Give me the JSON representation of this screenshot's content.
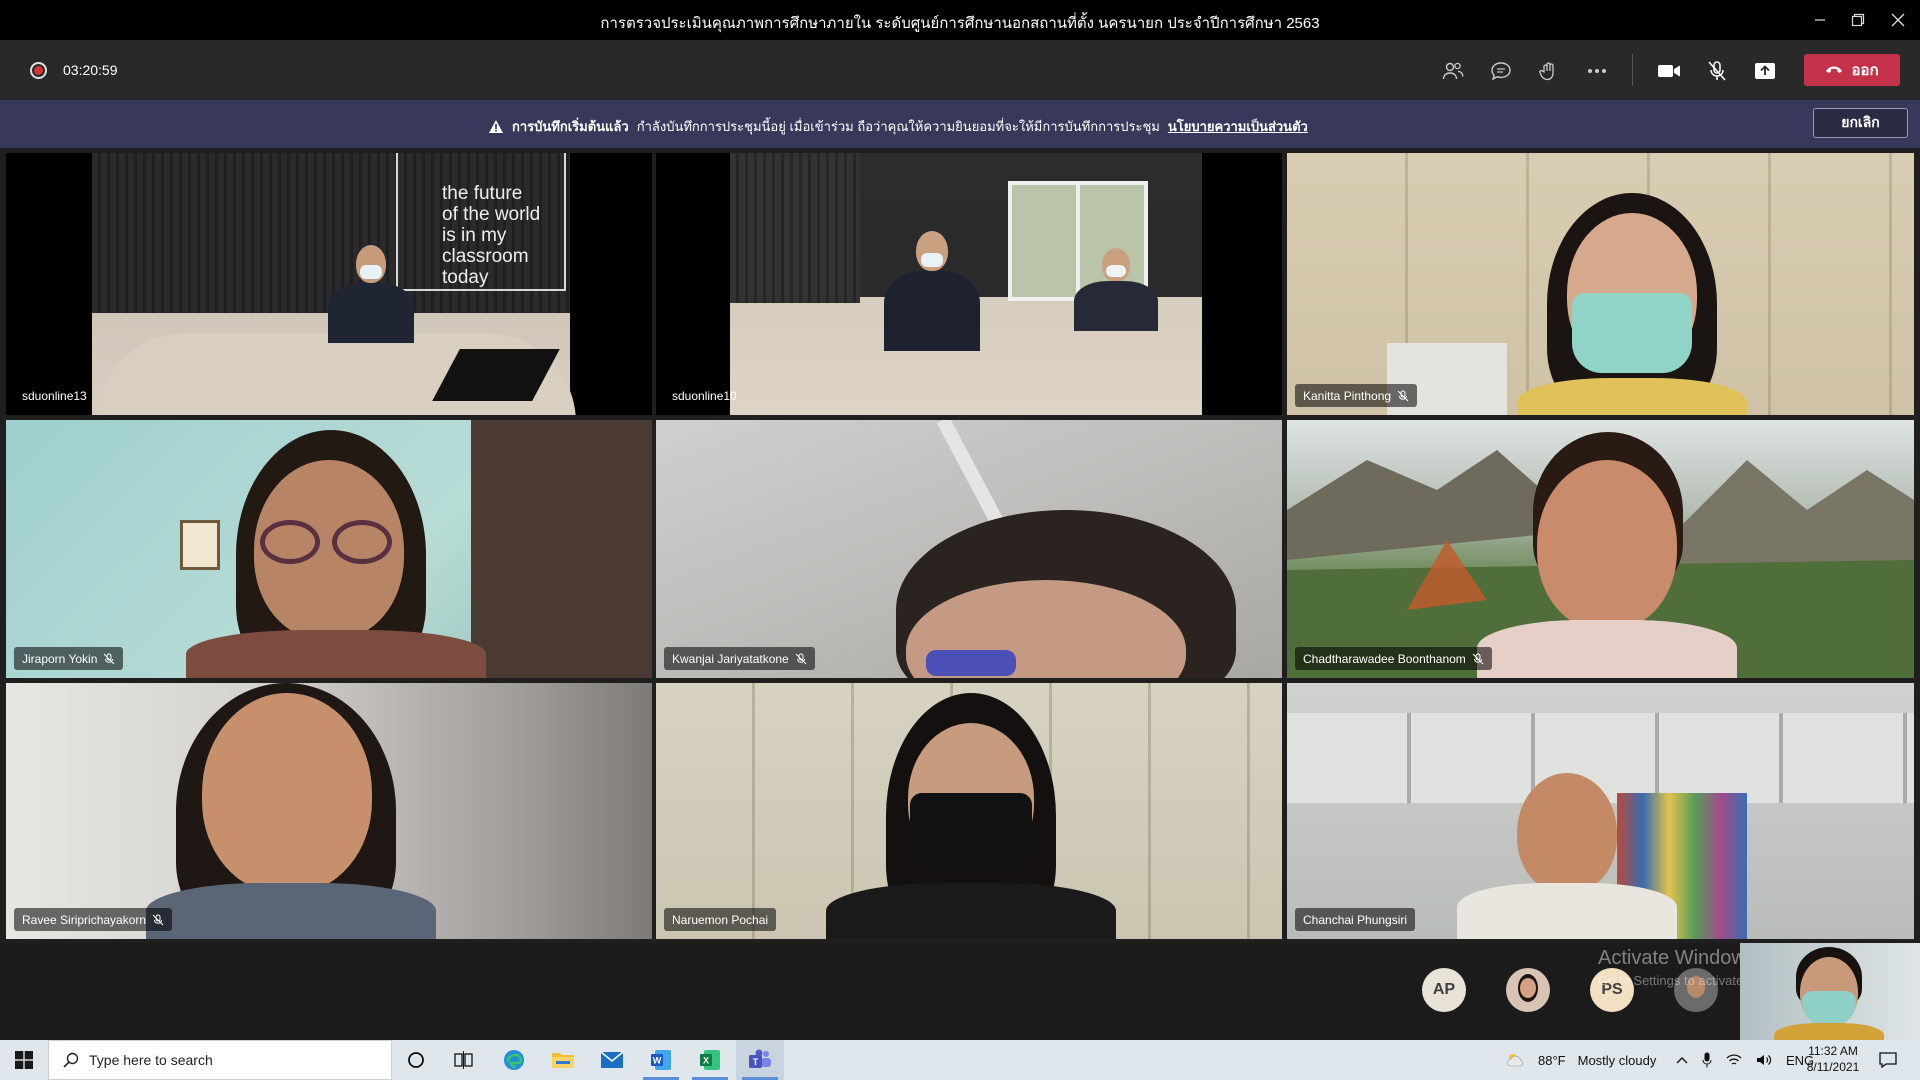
{
  "window": {
    "title": "การตรวจประเมินคุณภาพการศึกษาภายใน ระดับศูนย์การศึกษานอกสถานที่ตั้ง นครนายก ประจำปีการศึกษา 2563"
  },
  "controls": {
    "timer": "03:20:59",
    "leave_label": "ออก",
    "icons": [
      "participants-icon",
      "chat-icon",
      "reactions-icon",
      "more-icon",
      "camera-icon",
      "mic-off-icon",
      "share-icon"
    ]
  },
  "banner": {
    "bold": "การบันทึกเริ่มต้นแล้ว",
    "message": "กำลังบันทึกการประชุมนี้อยู่ เมื่อเข้าร่วม ถือว่าคุณให้ความยินยอมที่จะให้มีการบันทึกการประชุม",
    "link": "นโยบายความเป็นส่วนตัว",
    "cancel_label": "ยกเลิก"
  },
  "tiles": [
    {
      "name": "sduonline13",
      "muted": false,
      "room_text": "the future\nof the world\nis in my\nclassroom\ntoday"
    },
    {
      "name": "sduonline10",
      "muted": false
    },
    {
      "name": "Kanitta Pinthong",
      "muted": true
    },
    {
      "name": "Jiraporn Yokin",
      "muted": true
    },
    {
      "name": "Kwanjai Jariyatatkone",
      "muted": true
    },
    {
      "name": "Chadtharawadee Boonthanom",
      "muted": true
    },
    {
      "name": "Ravee Siriprichayakorn",
      "muted": true
    },
    {
      "name": "Naruemon Pochai",
      "muted": false
    },
    {
      "name": "Chanchai Phungsiri",
      "muted": false
    }
  ],
  "overflow": {
    "avatars": [
      {
        "initials": "AP",
        "bg": "#e8e3d6",
        "fg": "#404040"
      },
      {
        "initials": "",
        "bg": "#d9c3b4",
        "fg": "#404040"
      },
      {
        "initials": "PS",
        "bg": "#f2e0c2",
        "fg": "#404040"
      },
      {
        "initials": "",
        "bg": "#6b6b6b",
        "fg": "#ffffff"
      }
    ],
    "activate_title": "Activate Windows",
    "activate_sub": "Go to Settings to activate Windows."
  },
  "taskbar": {
    "search_placeholder": "Type here to search",
    "weather_temp": "88°F",
    "weather_desc": "Mostly cloudy",
    "lang": "ENG",
    "time": "11:32 AM",
    "date": "8/11/2021"
  },
  "colors": {
    "leave": "#c4314b",
    "banner": "#38395a",
    "accent": "#6264a7"
  }
}
